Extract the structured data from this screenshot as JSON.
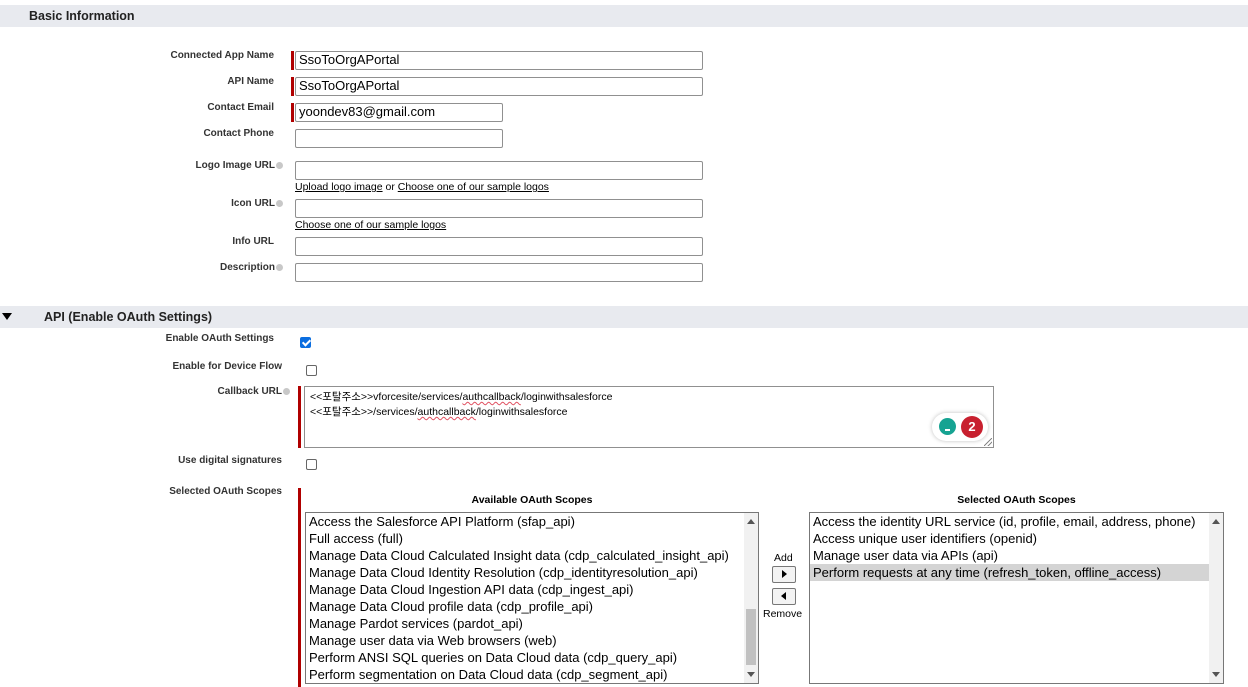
{
  "basic_section": {
    "title": "Basic Information",
    "fields": {
      "app_name": {
        "label": "Connected App Name",
        "value": "SsoToOrgAPortal"
      },
      "api_name": {
        "label": "API Name",
        "value": "SsoToOrgAPortal"
      },
      "contact_email": {
        "label": "Contact Email",
        "value": "yoondev83@gmail.com"
      },
      "contact_phone": {
        "label": "Contact Phone",
        "value": ""
      },
      "logo_url": {
        "label": "Logo Image URL",
        "value": ""
      },
      "icon_url": {
        "label": "Icon URL",
        "value": ""
      },
      "info_url": {
        "label": "Info URL",
        "value": ""
      },
      "description": {
        "label": "Description",
        "value": ""
      }
    },
    "logo_links": {
      "upload": "Upload logo image",
      "or": "or",
      "choose": "Choose one of our sample logos"
    },
    "icon_links": {
      "choose": "Choose one of our sample logos"
    }
  },
  "api_section": {
    "title": "API (Enable OAuth Settings)",
    "enable_oauth": {
      "label": "Enable OAuth Settings",
      "checked": true
    },
    "device_flow": {
      "label": "Enable for Device Flow",
      "checked": false
    },
    "callback": {
      "label": "Callback URL",
      "line1": {
        "pre": "<<포탈주소>>vforcesite/services/",
        "mark": "authcallback",
        "post": "/loginwithsalesforce"
      },
      "line2": {
        "pre": "<<포탈주소>>/services/",
        "mark": "authcallback",
        "post": "/loginwithsalesforce"
      }
    },
    "grammar_badge_count": "2",
    "digital_signatures": {
      "label": "Use digital signatures",
      "checked": false
    },
    "scopes": {
      "label": "Selected OAuth Scopes",
      "available_title": "Available OAuth Scopes",
      "selected_title": "Selected OAuth Scopes",
      "add_label": "Add",
      "remove_label": "Remove",
      "available": [
        "Access the Salesforce API Platform (sfap_api)",
        "Full access (full)",
        "Manage Data Cloud Calculated Insight data (cdp_calculated_insight_api)",
        "Manage Data Cloud Identity Resolution (cdp_identityresolution_api)",
        "Manage Data Cloud Ingestion API data (cdp_ingest_api)",
        "Manage Data Cloud profile data (cdp_profile_api)",
        "Manage Pardot services (pardot_api)",
        "Manage user data via Web browsers (web)",
        "Perform ANSI SQL queries on Data Cloud data (cdp_query_api)",
        "Perform segmentation on Data Cloud data (cdp_segment_api)"
      ],
      "selected": [
        "Access the identity URL service (id, profile, email, address, phone)",
        "Access unique user identifiers (openid)",
        "Manage user data via APIs (api)",
        "Perform requests at any time (refresh_token, offline_access)"
      ],
      "highlighted_selected_index": 3
    }
  },
  "colors": {
    "required_bar": "#b00000",
    "section_bg": "#e8eaef",
    "checkbox_on": "#0b6ee0",
    "badge": "#c8202f",
    "bulb": "#16a392"
  }
}
